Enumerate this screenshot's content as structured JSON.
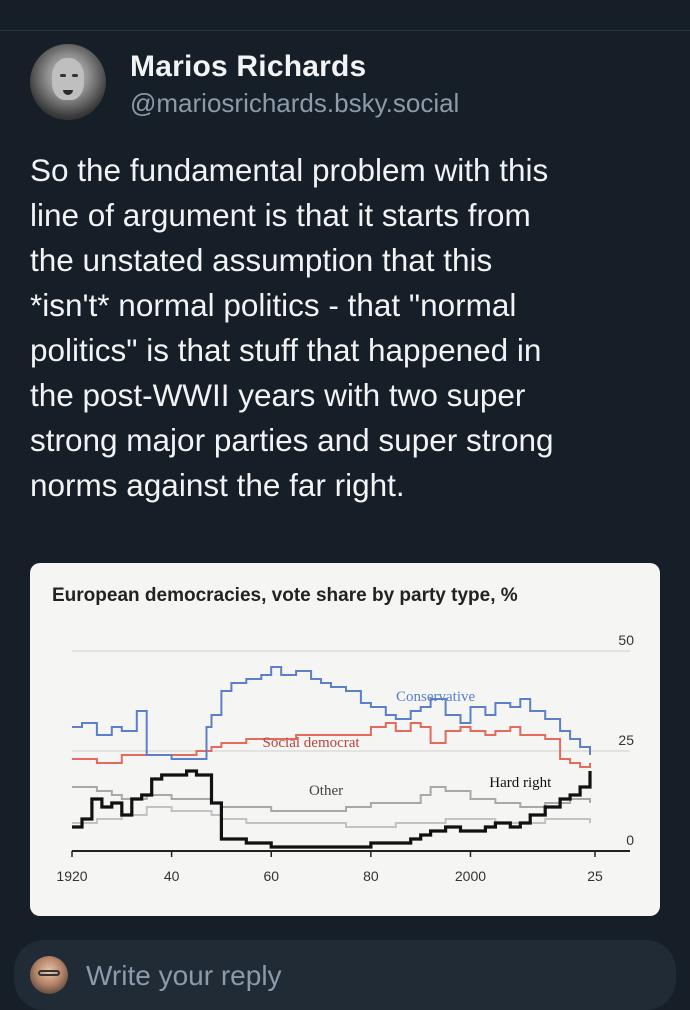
{
  "post": {
    "author_name": "Marios Richards",
    "author_handle": "@mariosrichards.bsky.social",
    "text": "So the fundamental problem with this\nline of argument is that it starts from\nthe unstated assumption that this\n*isn't* normal politics - that \"normal\npolitics\" is that stuff that happened in\nthe post-WWII years with two super\nstrong major parties and super strong\nnorms against the far right."
  },
  "reply": {
    "placeholder": "Write your reply"
  },
  "chart_data": {
    "type": "line",
    "title": "European democracies, vote share by party type, %",
    "xlabel": "",
    "ylabel": "",
    "xlim": [
      1920,
      2025
    ],
    "ylim": [
      0,
      50
    ],
    "x_ticks": [
      1920,
      1940,
      1960,
      1980,
      2000,
      2025
    ],
    "x_tick_labels": [
      "1920",
      "40",
      "60",
      "80",
      "2000",
      "25"
    ],
    "y_ticks": [
      0,
      25,
      50
    ],
    "y_tick_labels": [
      "0",
      "25",
      "50"
    ],
    "grid": true,
    "series": [
      {
        "name": "Conservative",
        "color": "#5b7fc8",
        "x": [
          1920,
          1922,
          1925,
          1928,
          1930,
          1933,
          1935,
          1938,
          1940,
          1945,
          1947,
          1948,
          1950,
          1952,
          1955,
          1958,
          1960,
          1962,
          1965,
          1968,
          1970,
          1972,
          1975,
          1978,
          1980,
          1983,
          1985,
          1988,
          1990,
          1992,
          1995,
          1998,
          2000,
          2003,
          2005,
          2008,
          2010,
          2012,
          2015,
          2018,
          2020,
          2022,
          2024
        ],
        "values": [
          31,
          32,
          29,
          31,
          30,
          35,
          24,
          24,
          23,
          23,
          31,
          34,
          40,
          42,
          43,
          44,
          46,
          44,
          45,
          43,
          42,
          41,
          40,
          37,
          36,
          34,
          33,
          35,
          36,
          38,
          34,
          32,
          36,
          34,
          37,
          36,
          38,
          35,
          33,
          30,
          28,
          26,
          24
        ]
      },
      {
        "name": "Social democrat",
        "color": "#e46a5e",
        "x": [
          1920,
          1925,
          1930,
          1935,
          1940,
          1945,
          1948,
          1950,
          1955,
          1960,
          1965,
          1970,
          1975,
          1980,
          1983,
          1985,
          1988,
          1990,
          1992,
          1995,
          1998,
          2000,
          2003,
          2005,
          2008,
          2010,
          2012,
          2015,
          2018,
          2020,
          2022,
          2024
        ],
        "values": [
          23,
          22,
          24,
          24,
          24,
          25,
          26,
          27,
          28,
          28,
          29,
          29,
          29,
          31,
          32,
          30,
          32,
          31,
          27,
          30,
          31,
          30,
          29,
          30,
          31,
          29,
          29,
          28,
          23,
          22,
          21,
          22
        ]
      },
      {
        "name": "Other",
        "color": "#a8a8a8",
        "x": [
          1920,
          1925,
          1928,
          1930,
          1935,
          1940,
          1945,
          1948,
          1950,
          1955,
          1960,
          1965,
          1970,
          1975,
          1980,
          1985,
          1990,
          1992,
          1995,
          2000,
          2005,
          2010,
          2015,
          2020,
          2024
        ],
        "values": [
          16,
          15,
          14,
          13,
          14,
          13,
          13,
          12,
          11,
          11,
          10,
          10,
          10,
          11,
          12,
          12,
          14,
          16,
          15,
          13,
          12,
          11,
          12,
          13,
          12
        ]
      },
      {
        "name": "",
        "color": "#c2c2c2",
        "x": [
          1920,
          1925,
          1930,
          1935,
          1940,
          1945,
          1948,
          1950,
          1955,
          1960,
          1965,
          1970,
          1975,
          1980,
          1985,
          1990,
          1995,
          2000,
          2005,
          2010,
          2015,
          2020,
          2024
        ],
        "values": [
          7,
          8,
          9,
          11,
          10,
          10,
          9,
          8,
          7,
          7,
          7,
          7,
          6,
          6,
          7,
          7,
          8,
          8,
          7,
          7,
          8,
          8,
          7
        ]
      },
      {
        "name": "Hard right",
        "color": "#111111",
        "x": [
          1920,
          1922,
          1924,
          1926,
          1928,
          1930,
          1932,
          1934,
          1936,
          1938,
          1940,
          1943,
          1945,
          1948,
          1950,
          1955,
          1960,
          1965,
          1970,
          1975,
          1980,
          1985,
          1988,
          1990,
          1992,
          1995,
          1998,
          2000,
          2003,
          2005,
          2008,
          2010,
          2012,
          2015,
          2018,
          2020,
          2022,
          2024
        ],
        "values": [
          6,
          8,
          13,
          11,
          12,
          9,
          13,
          14,
          18,
          19,
          19,
          20,
          19,
          12,
          3,
          2,
          1,
          1,
          1,
          1,
          2,
          2,
          3,
          4,
          5,
          6,
          5,
          5,
          6,
          7,
          6,
          7,
          9,
          11,
          13,
          14,
          16,
          20
        ]
      }
    ]
  }
}
